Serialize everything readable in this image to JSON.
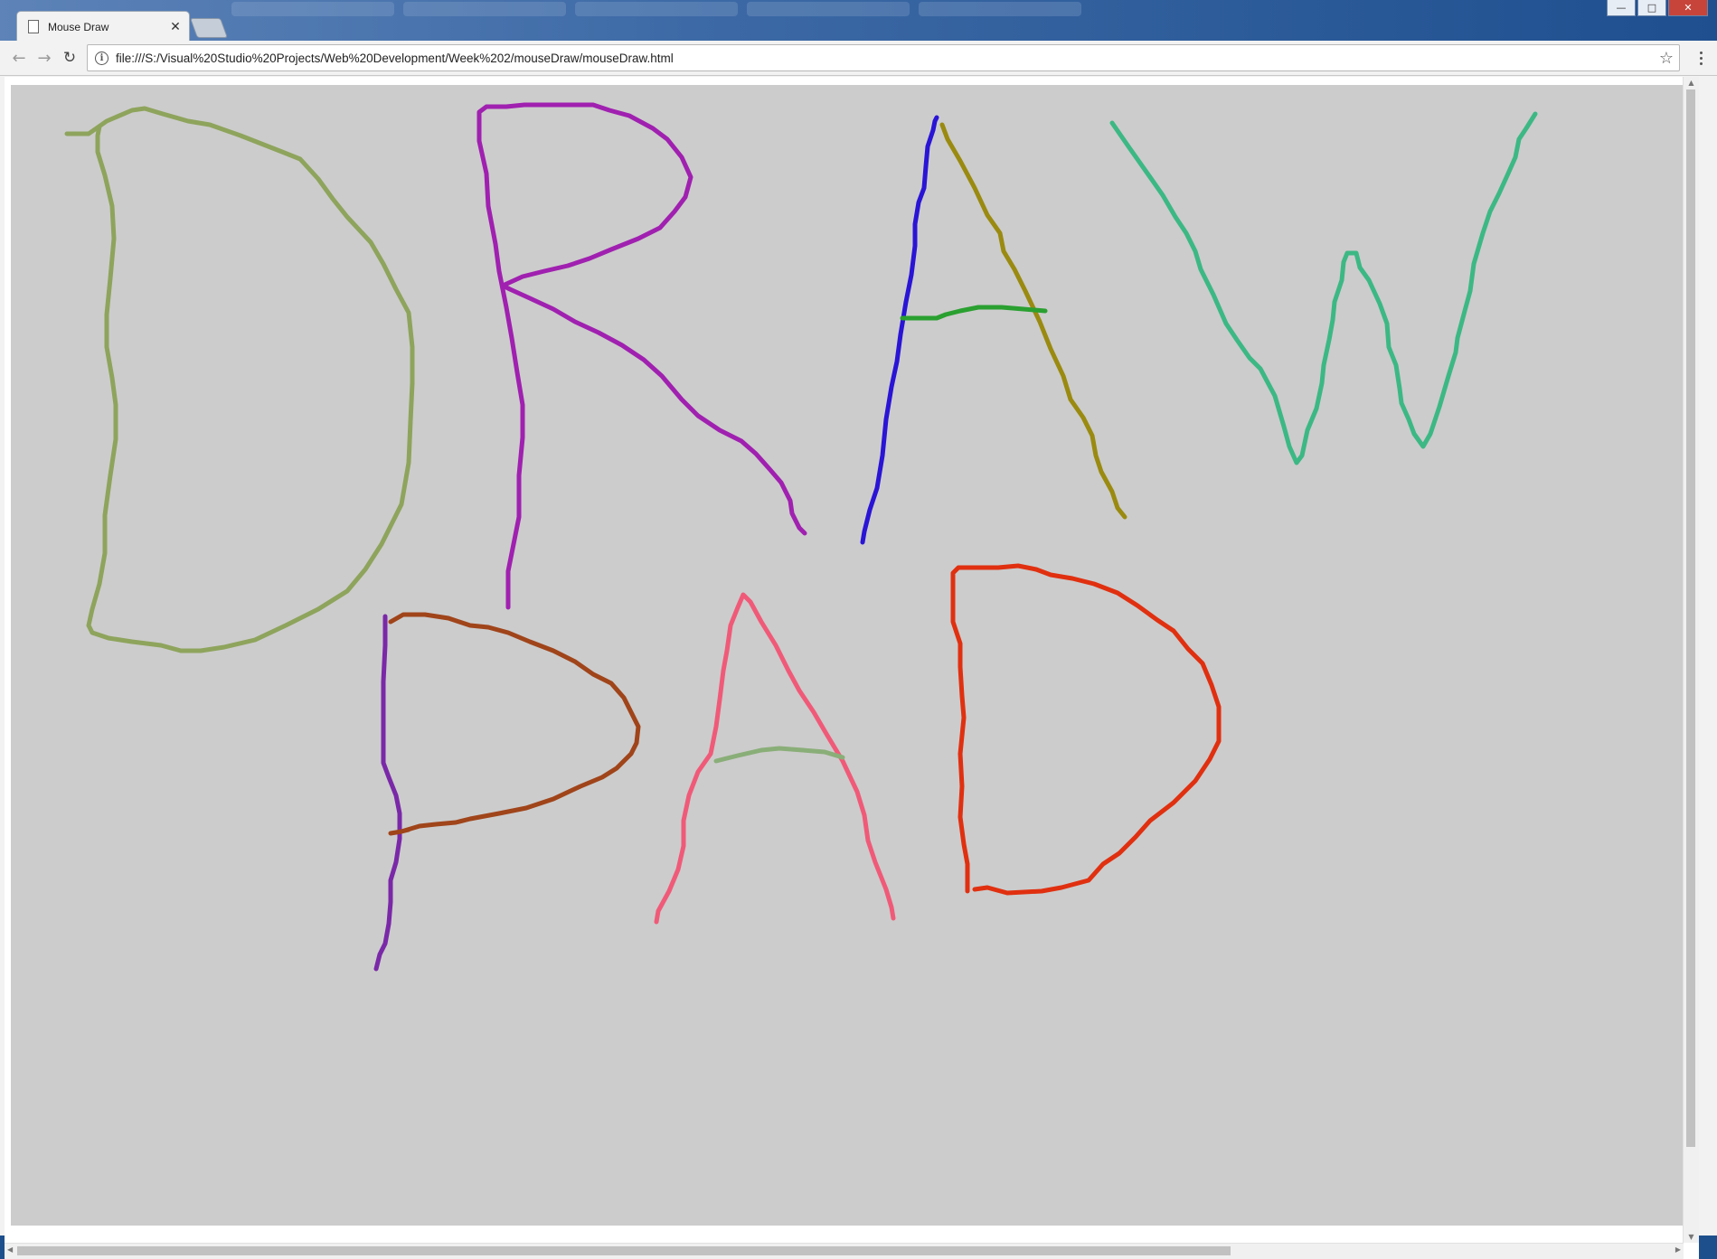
{
  "window": {
    "controls": [
      "minimize",
      "maximize",
      "close"
    ]
  },
  "tabs": [
    {
      "title": "Mouse Draw",
      "active": true
    }
  ],
  "toolbar": {
    "url": "file:///S:/Visual%20Studio%20Projects/Web%20Development/Week%202/mouseDraw/mouseDraw.html",
    "icons": [
      "back-icon",
      "forward-icon",
      "reload-icon",
      "info-icon",
      "star-icon",
      "menu-icon"
    ]
  },
  "canvas": {
    "background": "#cccccc",
    "strokes": [
      {
        "letter": "D",
        "color": "#8ea45c"
      },
      {
        "letter": "R",
        "color": "#a020b0"
      },
      {
        "letter": "A-left",
        "color": "#2a14d6"
      },
      {
        "letter": "A-right",
        "color": "#9a8a10"
      },
      {
        "letter": "A-bar",
        "color": "#2aa030"
      },
      {
        "letter": "W",
        "color": "#3cb884"
      },
      {
        "letter": "P-stem",
        "color": "#7a28a8"
      },
      {
        "letter": "P-bowl",
        "color": "#a0441a"
      },
      {
        "letter": "A2",
        "color": "#f05a78"
      },
      {
        "letter": "A2-bar",
        "color": "#8aae78"
      },
      {
        "letter": "D2",
        "color": "#e03010"
      }
    ]
  }
}
